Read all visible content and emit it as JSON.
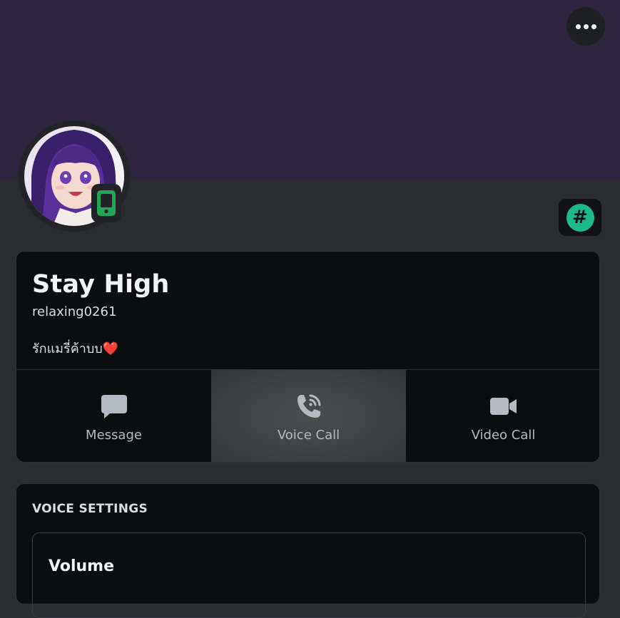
{
  "header": {
    "more_icon": "more-horizontal-icon"
  },
  "profile": {
    "display_name": "Stay High",
    "username": "relaxing0261",
    "bio": "รักแมรี่ค้าบบ❤️",
    "status_icon": "mobile-online-icon",
    "badge_icon": "hashtag-badge-icon",
    "status_color": "#23a55a",
    "badge_color": "#1db98a"
  },
  "actions": [
    {
      "label": "Message",
      "icon": "message-icon"
    },
    {
      "label": "Voice Call",
      "icon": "voice-call-icon"
    },
    {
      "label": "Video Call",
      "icon": "video-call-icon"
    }
  ],
  "voice_settings": {
    "title": "VOICE SETTINGS",
    "volume_label": "Volume"
  },
  "colors": {
    "banner": "#2e263e",
    "background": "#2b2d31",
    "card": "#0c0d0f"
  }
}
